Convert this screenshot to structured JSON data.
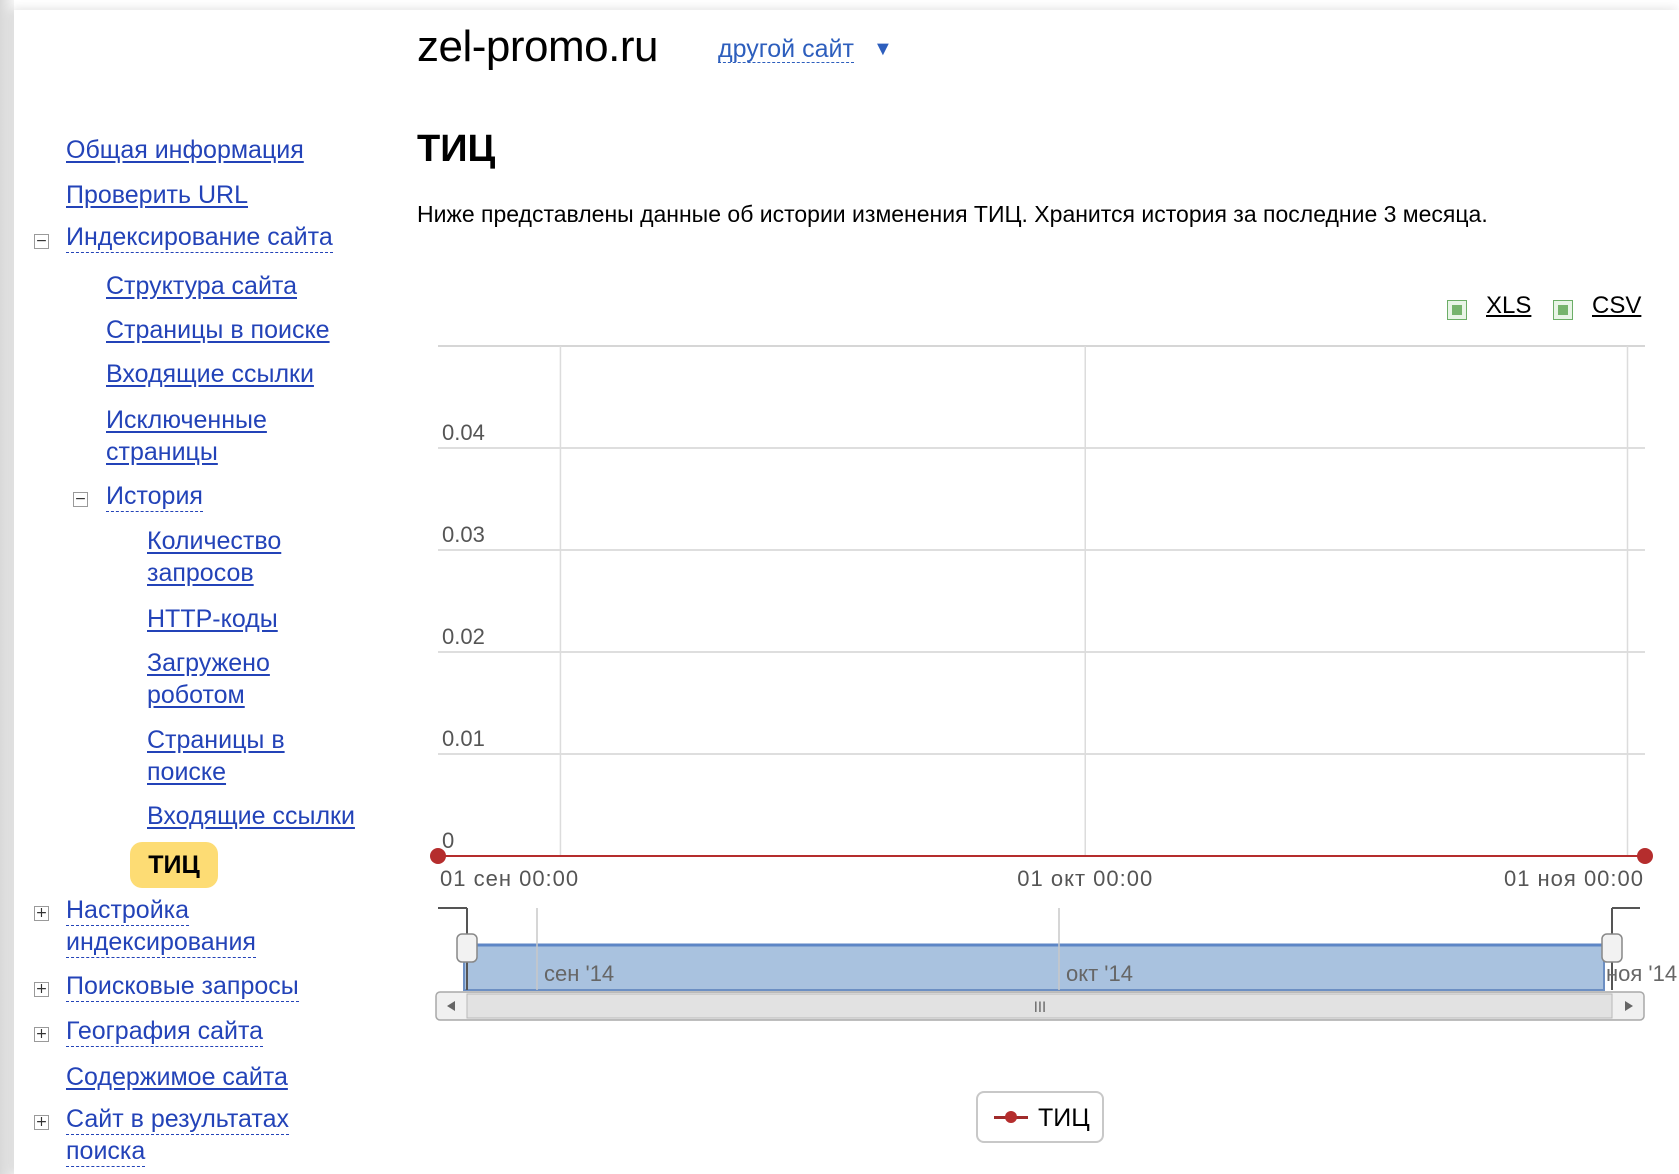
{
  "header": {
    "site": "zel-promo.ru",
    "other_site": "другой сайт",
    "caret": "▼"
  },
  "nav": {
    "general_info": "Общая информация",
    "check_url": "Проверить URL",
    "indexing": "Индексирование сайта",
    "site_structure": "Структура сайта",
    "pages_in_search": "Страницы в поиске",
    "incoming_links": "Входящие ссылки",
    "excluded_pages_1": "Исключенные",
    "excluded_pages_2": "страницы",
    "history": "История",
    "query_count_1": "Количество",
    "query_count_2": "запросов",
    "http_codes": "HTTP-коды",
    "loaded_by_robot_1": "Загружено",
    "loaded_by_robot_2": "роботом",
    "hist_pages_1": "Страницы в",
    "hist_pages_2": "поиске",
    "hist_incoming": "Входящие ссылки",
    "tic": "ТИЦ",
    "index_settings_1": "Настройка",
    "index_settings_2": "индексирования",
    "search_queries": "Поисковые запросы",
    "geography": "География сайта",
    "content": "Содержимое сайта",
    "in_results_1": "Сайт в результатах",
    "in_results_2": "поиска",
    "toggle_minus": "−",
    "toggle_plus": "+"
  },
  "main": {
    "heading": "ТИЦ",
    "description": "Ниже представлены данные об истории изменения ТИЦ. Хранится история за последние 3 месяца.",
    "export_xls": "XLS",
    "export_csv": "CSV",
    "legend": "ТИЦ"
  },
  "chart_data": {
    "type": "line",
    "title": "",
    "xlabel": "",
    "ylabel": "",
    "ylim": [
      0,
      0.05
    ],
    "y_ticks": [
      "0",
      "0.01",
      "0.02",
      "0.03",
      "0.04"
    ],
    "x_ticks": [
      "01 сен 00:00",
      "01 окт 00:00",
      "01 ноя 00:00"
    ],
    "navigator_labels": [
      "сен '14",
      "окт '14",
      "ноя '14"
    ],
    "navigator_handle": "III",
    "grid": true,
    "series": [
      {
        "name": "ТИЦ",
        "color": "#b52d2d",
        "points": [
          {
            "x": "2014-08-25",
            "y": 0
          },
          {
            "x": "2014-11-02",
            "y": 0
          }
        ]
      }
    ]
  }
}
